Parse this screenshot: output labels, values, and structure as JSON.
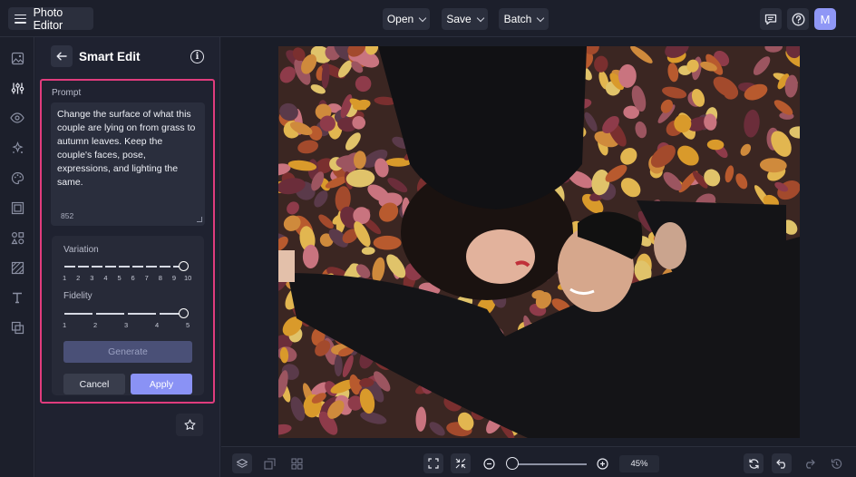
{
  "app": {
    "title": "Photo Editor"
  },
  "topbar": {
    "menus": [
      {
        "label": "Open"
      },
      {
        "label": "Save"
      },
      {
        "label": "Batch"
      }
    ],
    "icons": [
      "feedback-icon",
      "help-icon"
    ],
    "avatar_initial": "M"
  },
  "rail": {
    "tools": [
      "image-icon",
      "adjust-icon",
      "eye-icon",
      "effects-icon",
      "paint-icon",
      "frame-icon",
      "graphics-icon",
      "texture-icon",
      "text-icon",
      "overlay-icon"
    ],
    "active_index": 1
  },
  "panel": {
    "title": "Smart Edit",
    "prompt_label": "Prompt",
    "prompt_text": "Change the surface of what this couple are lying on from grass to autumn leaves. Keep the couple's faces, pose, expressions, and lighting the same.",
    "prompt_count": "852",
    "variation": {
      "label": "Variation",
      "ticks": [
        "1",
        "2",
        "3",
        "4",
        "5",
        "6",
        "7",
        "8",
        "9",
        "10"
      ],
      "value": 10
    },
    "fidelity": {
      "label": "Fidelity",
      "ticks": [
        "1",
        "2",
        "3",
        "4",
        "5"
      ],
      "value": 5
    },
    "generate_label": "Generate",
    "cancel_label": "Cancel",
    "apply_label": "Apply"
  },
  "bottombar": {
    "zoom": "45%"
  },
  "colors": {
    "accent": "#8a92f5",
    "highlight": "#e03c7d",
    "bg": "#1c1f2b"
  }
}
